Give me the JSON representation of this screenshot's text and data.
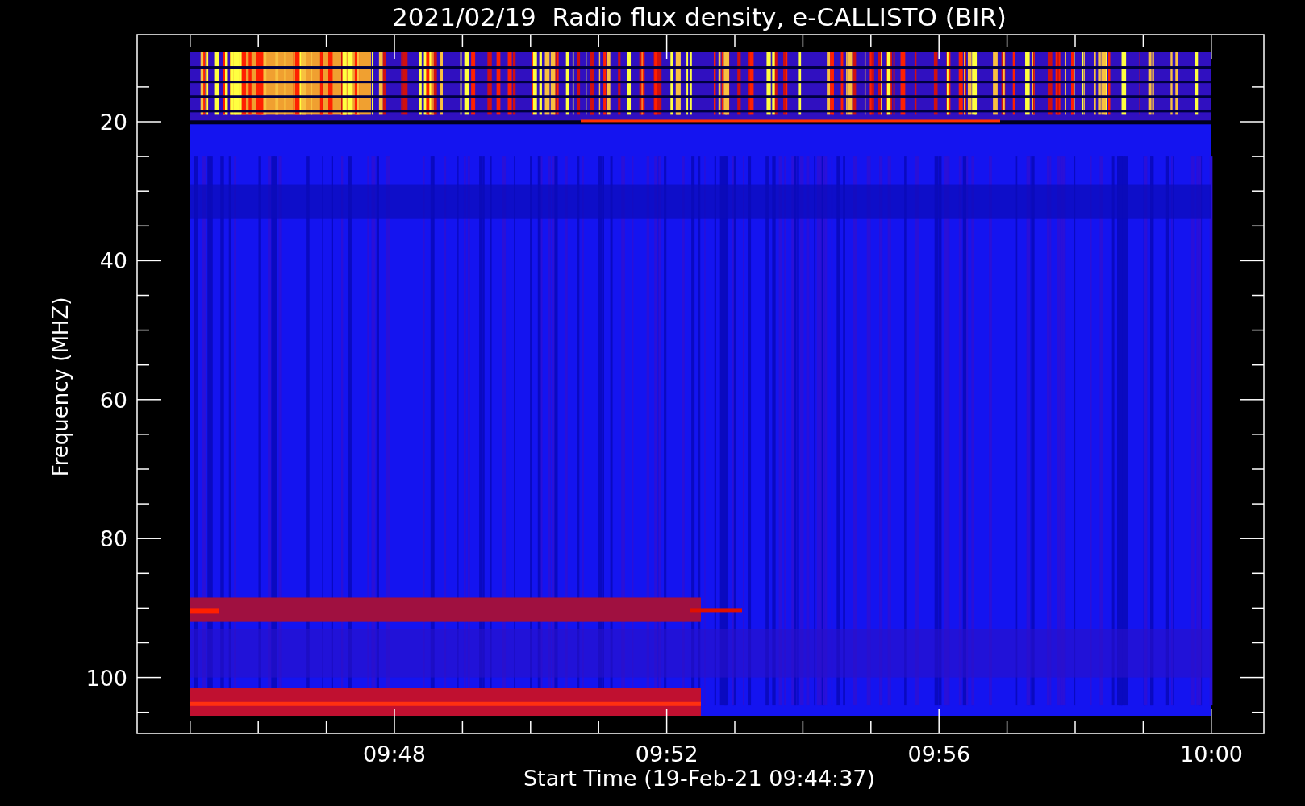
{
  "title": "2021/02/19  Radio flux density, e-CALLISTO (BIR)",
  "y_axis": {
    "label": "Frequency (MHZ)",
    "ticks": [
      "20",
      "40",
      "60",
      "80",
      "100"
    ]
  },
  "x_axis": {
    "label": "Start Time (19-Feb-21 09:44:37)",
    "ticks": [
      "09:48",
      "09:52",
      "09:56",
      "10:00"
    ]
  }
}
